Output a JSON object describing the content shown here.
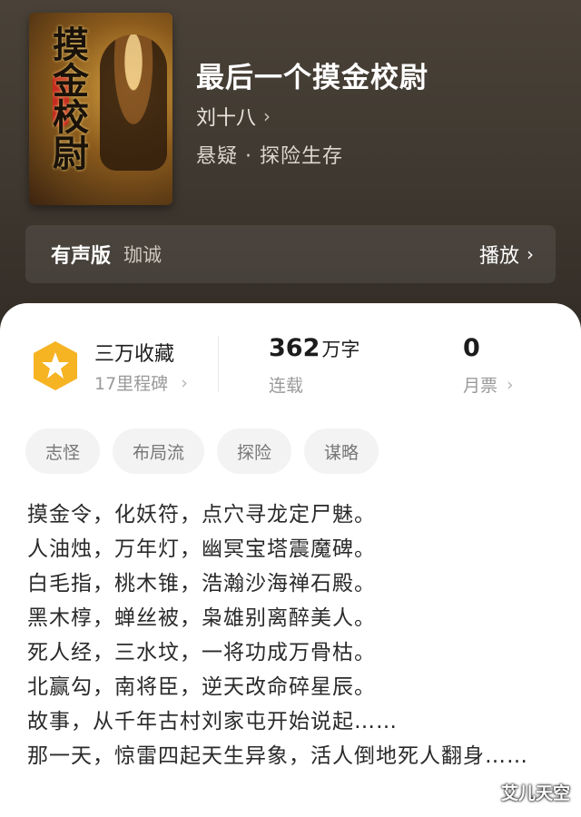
{
  "book": {
    "cover_title": "摸金校尉",
    "title": "最后一个摸金校尉",
    "author": "刘十八",
    "genre": "悬疑 · 探险生存"
  },
  "audio": {
    "label": "有声版",
    "narrator": "珈诚",
    "play_label": "播放"
  },
  "stats": {
    "collect_title": "三万收藏",
    "milestones": "17里程碑",
    "word_count": "362",
    "word_unit": "万字",
    "status": "连载",
    "monthly_votes": "0",
    "monthly_label": "月票"
  },
  "tags": [
    "志怪",
    "布局流",
    "探险",
    "谋略"
  ],
  "description": [
    "摸金令，化妖符，点穴寻龙定尸魅。",
    "人油烛，万年灯，幽冥宝塔震魔碑。",
    "白毛指，桃木锥，浩瀚沙海禅石殿。",
    "黑木椁，蝉丝被，枭雄别离醉美人。",
    "死人经，三水坟，一将功成万骨枯。",
    "北赢勾，南将臣，逆天改命碎星辰。",
    "故事，从千年古村刘家屯开始说起……",
    "那一天，惊雷四起天生异象，活人倒地死人翻身……"
  ],
  "watermark": "艾儿天空",
  "colors": {
    "badge": "#f6b322",
    "hero_bg": "#3f3830"
  },
  "icons": {
    "badge": "star-badge-icon",
    "chevron": "chevron-right-icon"
  }
}
